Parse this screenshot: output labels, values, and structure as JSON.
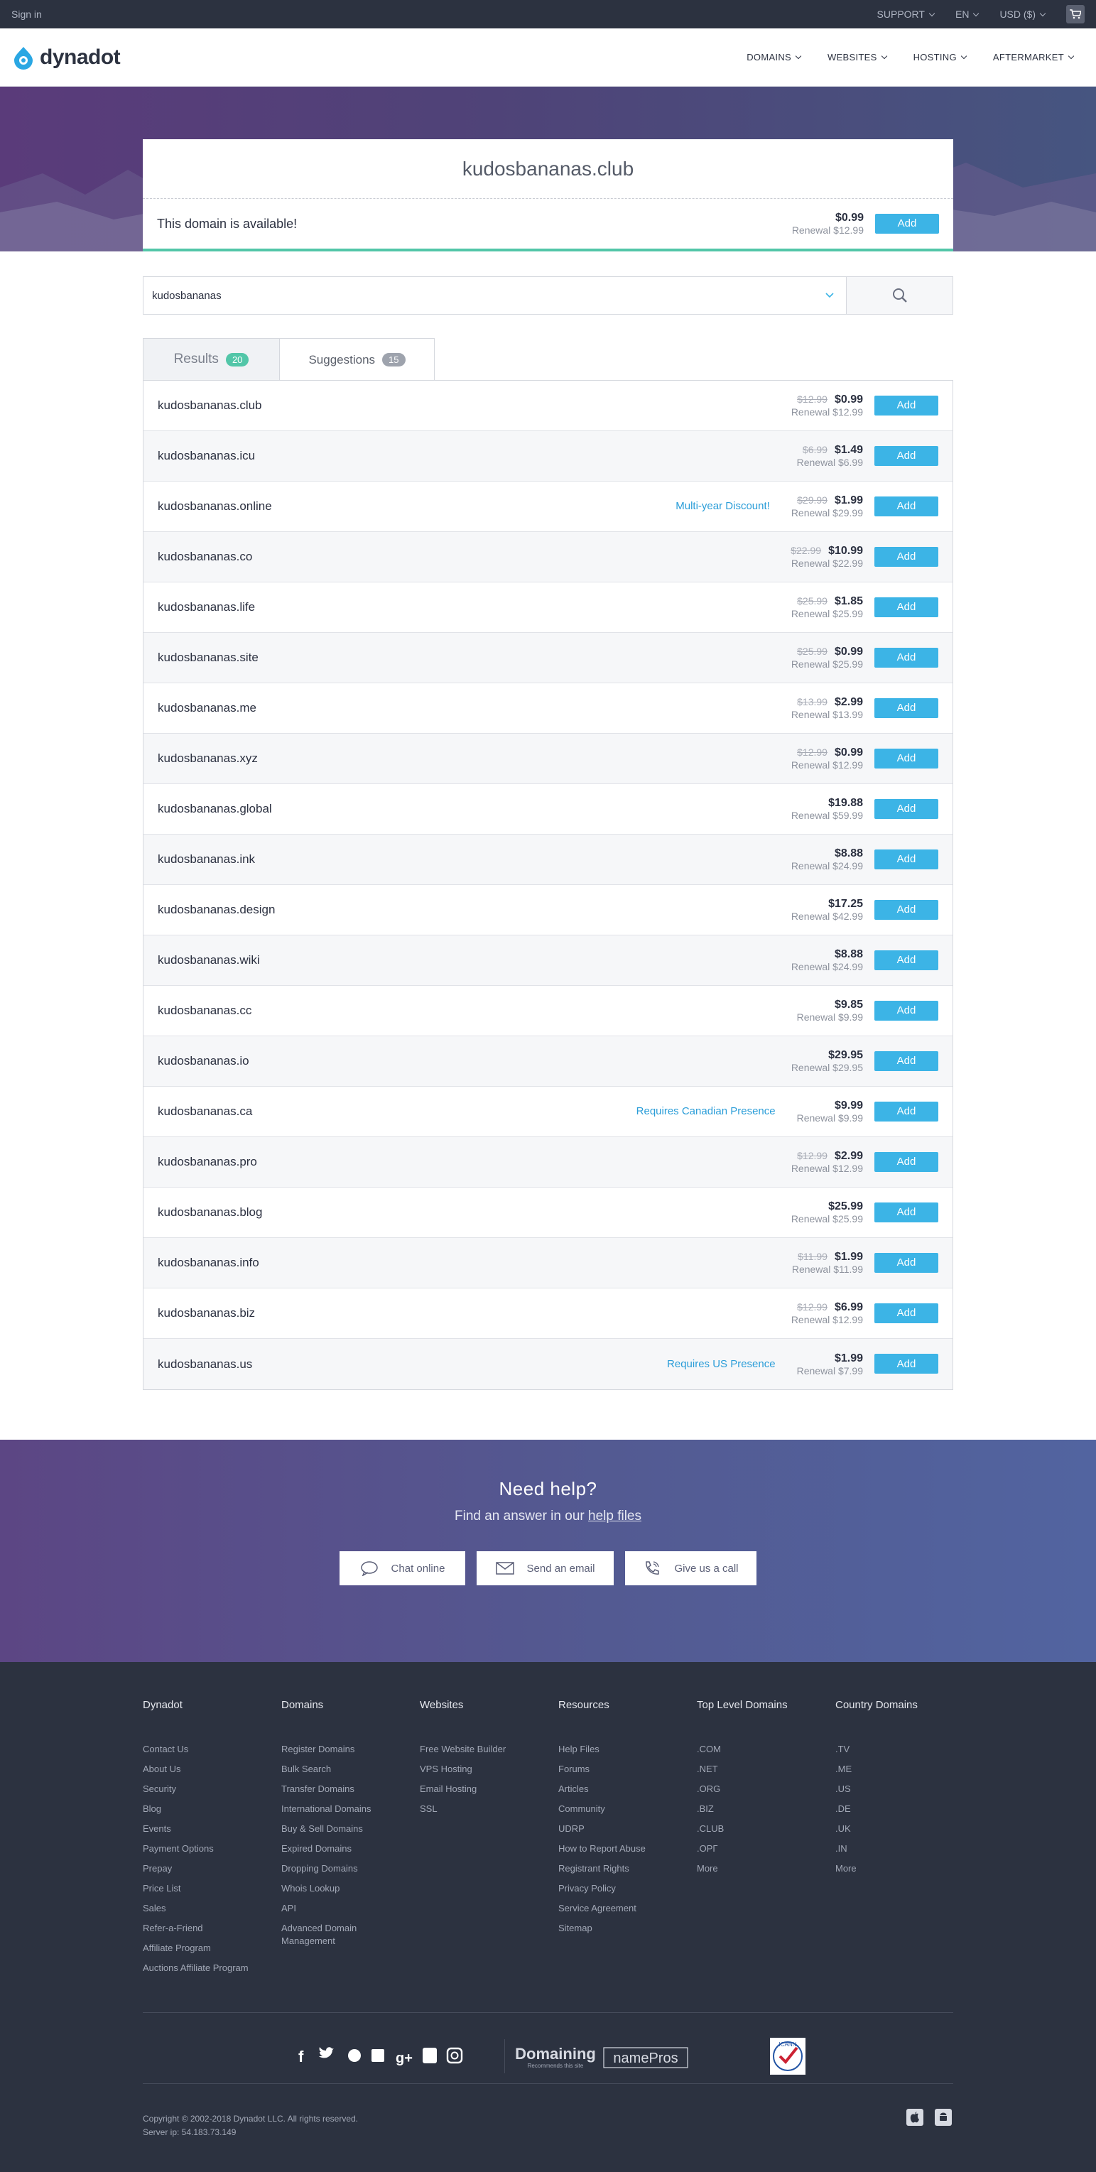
{
  "topbar": {
    "signin": "Sign in",
    "support": "SUPPORT",
    "lang": "EN",
    "currency": "USD ($)"
  },
  "header": {
    "logo": "dynadot",
    "nav": [
      "DOMAINS",
      "WEBSITES",
      "HOSTING",
      "AFTERMARKET"
    ]
  },
  "hero": {
    "domain": "kudosbananas.club",
    "status": "This domain is available!",
    "price": "$0.99",
    "renewal": "Renewal $12.99",
    "add": "Add"
  },
  "search": {
    "value": "kudosbananas"
  },
  "tabs": [
    {
      "label": "Results",
      "count": "20"
    },
    {
      "label": "Suggestions",
      "count": "15"
    }
  ],
  "results": [
    {
      "name": "kudosbananas.club",
      "old": "$12.99",
      "price": "$0.99",
      "renewal": "Renewal $12.99",
      "note": ""
    },
    {
      "name": "kudosbananas.icu",
      "old": "$6.99",
      "price": "$1.49",
      "renewal": "Renewal $6.99",
      "note": ""
    },
    {
      "name": "kudosbananas.online",
      "old": "$29.99",
      "price": "$1.99",
      "renewal": "Renewal $29.99",
      "note": "Multi-year Discount!"
    },
    {
      "name": "kudosbananas.co",
      "old": "$22.99",
      "price": "$10.99",
      "renewal": "Renewal $22.99",
      "note": ""
    },
    {
      "name": "kudosbananas.life",
      "old": "$25.99",
      "price": "$1.85",
      "renewal": "Renewal $25.99",
      "note": ""
    },
    {
      "name": "kudosbananas.site",
      "old": "$25.99",
      "price": "$0.99",
      "renewal": "Renewal $25.99",
      "note": ""
    },
    {
      "name": "kudosbananas.me",
      "old": "$13.99",
      "price": "$2.99",
      "renewal": "Renewal $13.99",
      "note": ""
    },
    {
      "name": "kudosbananas.xyz",
      "old": "$12.99",
      "price": "$0.99",
      "renewal": "Renewal $12.99",
      "note": ""
    },
    {
      "name": "kudosbananas.global",
      "old": "",
      "price": "$19.88",
      "renewal": "Renewal $59.99",
      "note": ""
    },
    {
      "name": "kudosbananas.ink",
      "old": "",
      "price": "$8.88",
      "renewal": "Renewal $24.99",
      "note": ""
    },
    {
      "name": "kudosbananas.design",
      "old": "",
      "price": "$17.25",
      "renewal": "Renewal $42.99",
      "note": ""
    },
    {
      "name": "kudosbananas.wiki",
      "old": "",
      "price": "$8.88",
      "renewal": "Renewal $24.99",
      "note": ""
    },
    {
      "name": "kudosbananas.cc",
      "old": "",
      "price": "$9.85",
      "renewal": "Renewal $9.99",
      "note": ""
    },
    {
      "name": "kudosbananas.io",
      "old": "",
      "price": "$29.95",
      "renewal": "Renewal $29.95",
      "note": ""
    },
    {
      "name": "kudosbananas.ca",
      "old": "",
      "price": "$9.99",
      "renewal": "Renewal $9.99",
      "note": "Requires Canadian Presence"
    },
    {
      "name": "kudosbananas.pro",
      "old": "$12.99",
      "price": "$2.99",
      "renewal": "Renewal $12.99",
      "note": ""
    },
    {
      "name": "kudosbananas.blog",
      "old": "",
      "price": "$25.99",
      "renewal": "Renewal $25.99",
      "note": ""
    },
    {
      "name": "kudosbananas.info",
      "old": "$11.99",
      "price": "$1.99",
      "renewal": "Renewal $11.99",
      "note": ""
    },
    {
      "name": "kudosbananas.biz",
      "old": "$12.99",
      "price": "$6.99",
      "renewal": "Renewal $12.99",
      "note": ""
    },
    {
      "name": "kudosbananas.us",
      "old": "",
      "price": "$1.99",
      "renewal": "Renewal $7.99",
      "note": "Requires US Presence"
    }
  ],
  "add_label": "Add",
  "help": {
    "title": "Need help?",
    "text": "Find an answer in our",
    "link": "help files",
    "buttons": [
      "Chat online",
      "Send an email",
      "Give us a call"
    ]
  },
  "footer": {
    "columns": [
      {
        "title": "Dynadot",
        "items": [
          "Contact Us",
          "About Us",
          "Security",
          "Blog",
          "Events",
          "Payment Options",
          "Prepay",
          "Price List",
          "Sales",
          "Refer-a-Friend",
          "Affiliate Program",
          "Auctions Affiliate Program"
        ]
      },
      {
        "title": "Domains",
        "items": [
          "Register Domains",
          "Bulk Search",
          "Transfer Domains",
          "International Domains",
          "Buy & Sell Domains",
          "Expired Domains",
          "Dropping Domains",
          "Whois Lookup",
          "API",
          "Advanced Domain Management"
        ]
      },
      {
        "title": "Websites",
        "items": [
          "Free Website Builder",
          "VPS Hosting",
          "Email Hosting",
          "SSL"
        ]
      },
      {
        "title": "Resources",
        "items": [
          "Help Files",
          "Forums",
          "Articles",
          "Community",
          "UDRP",
          "How to Report Abuse",
          "Registrant Rights",
          "Privacy Policy",
          "Service Agreement",
          "Sitemap"
        ]
      },
      {
        "title": "Top Level Domains",
        "items": [
          ".COM",
          ".NET",
          ".ORG",
          ".BIZ",
          ".CLUB",
          ".ОРГ",
          "More"
        ]
      },
      {
        "title": "Country Domains",
        "items": [
          ".TV",
          ".ME",
          ".US",
          ".DE",
          ".UK",
          ".IN",
          "More"
        ]
      }
    ],
    "partners": [
      "Domaining",
      "Recommends this site",
      "namePros",
      "ICANN"
    ],
    "copyright": "Copyright © 2002-2018 Dynadot LLC. All rights reserved.",
    "server": "Server ip: 54.183.73.149"
  },
  "colors": {
    "accent": "#3cb4e6",
    "dark": "#2c3240",
    "green": "#52c6a8",
    "link": "#2a9dd8"
  }
}
